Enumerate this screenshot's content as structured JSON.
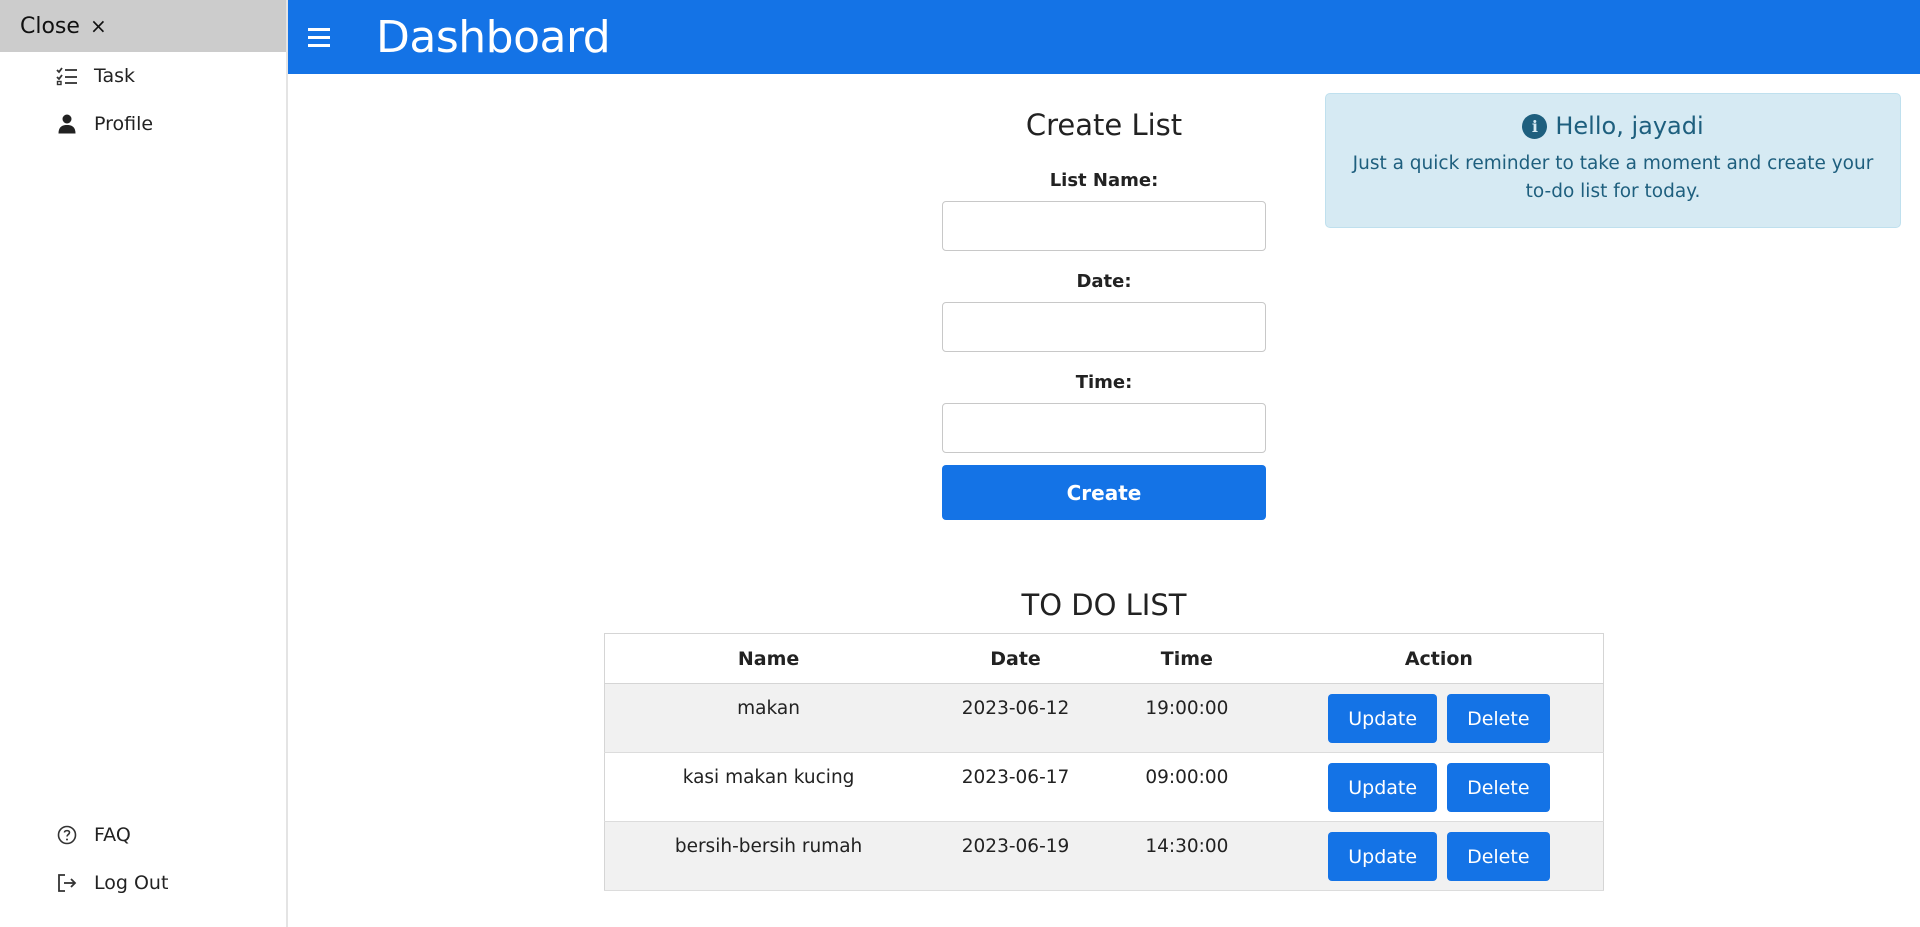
{
  "sidebar": {
    "close_label": "Close",
    "close_icon": "×",
    "items": [
      {
        "label": "Task",
        "icon": "task-list-icon"
      },
      {
        "label": "Profile",
        "icon": "person-icon"
      }
    ],
    "bottom_items": [
      {
        "label": "FAQ",
        "icon": "question-circle-icon"
      },
      {
        "label": "Log Out",
        "icon": "logout-icon"
      }
    ]
  },
  "header": {
    "title": "Dashboard",
    "menu_icon": "hamburger-icon",
    "color": "#1473e6"
  },
  "form": {
    "title": "Create List",
    "list_name_label": "List Name:",
    "date_label": "Date:",
    "time_label": "Time:",
    "list_name_value": "",
    "date_value": "",
    "time_value": "",
    "create_label": "Create"
  },
  "alert": {
    "icon": "info-circle-icon",
    "title": "Hello, jayadi",
    "message": "Just a quick reminder to take a moment and create your to-do list for today."
  },
  "todo": {
    "title": "TO DO LIST",
    "columns": [
      "Name",
      "Date",
      "Time",
      "Action"
    ],
    "rows": [
      {
        "name": "makan",
        "date": "2023-06-12",
        "time": "19:00:00",
        "update": "Update",
        "delete": "Delete"
      },
      {
        "name": "kasi makan kucing",
        "date": "2023-06-17",
        "time": "09:00:00",
        "update": "Update",
        "delete": "Delete"
      },
      {
        "name": "bersih-bersih rumah",
        "date": "2023-06-19",
        "time": "14:30:00",
        "update": "Update",
        "delete": "Delete"
      }
    ]
  }
}
